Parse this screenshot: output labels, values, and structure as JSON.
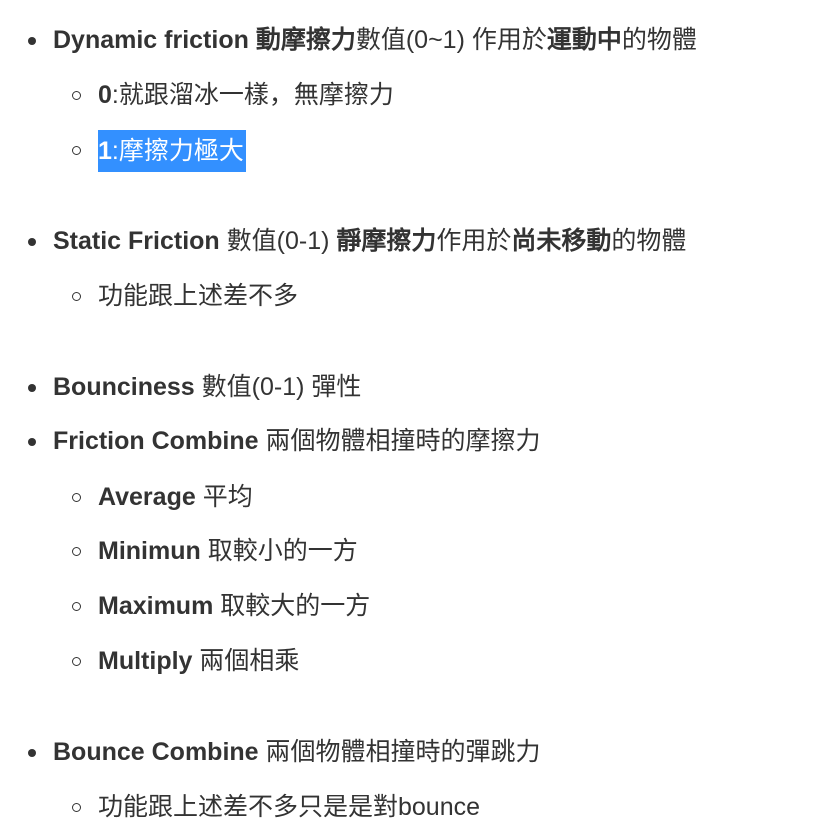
{
  "items": [
    {
      "id": "dynamic-friction",
      "level": 1,
      "parts": [
        {
          "t": "Dynamic friction ",
          "b": true
        },
        {
          "t": "動摩擦力",
          "b": true
        },
        {
          "t": "數值(0~1) 作用於",
          "b": false
        },
        {
          "t": "運動中",
          "b": true
        },
        {
          "t": "的物體",
          "b": false
        }
      ]
    },
    {
      "id": "dynamic-friction-0",
      "level": 2,
      "parts": [
        {
          "t": "0",
          "b": true
        },
        {
          "t": ":就跟溜冰一樣，無摩擦力",
          "b": false
        }
      ]
    },
    {
      "id": "dynamic-friction-1",
      "level": 2,
      "highlight": true,
      "parts": [
        {
          "t": "1",
          "b": true
        },
        {
          "t": ":摩擦力極大",
          "b": false
        }
      ]
    },
    {
      "id": "static-friction",
      "level": 1,
      "parts": [
        {
          "t": "Static Friction ",
          "b": true
        },
        {
          "t": "數值(0-1) ",
          "b": false
        },
        {
          "t": "靜摩擦力",
          "b": true
        },
        {
          "t": "作用於",
          "b": false
        },
        {
          "t": "尚未移動",
          "b": true
        },
        {
          "t": "的物體",
          "b": false
        }
      ]
    },
    {
      "id": "static-friction-note",
      "level": 2,
      "parts": [
        {
          "t": "功能跟上述差不多",
          "b": false
        }
      ]
    },
    {
      "id": "bounciness",
      "level": 1,
      "parts": [
        {
          "t": "Bounciness ",
          "b": true
        },
        {
          "t": "數值(0-1) 彈性",
          "b": false
        }
      ]
    },
    {
      "id": "friction-combine",
      "level": 1,
      "parts": [
        {
          "t": "Friction Combine ",
          "b": true
        },
        {
          "t": "兩個物體相撞時的摩擦力",
          "b": false
        }
      ]
    },
    {
      "id": "average",
      "level": 2,
      "parts": [
        {
          "t": "Average ",
          "b": true
        },
        {
          "t": "平均",
          "b": false
        }
      ]
    },
    {
      "id": "minimun",
      "level": 2,
      "parts": [
        {
          "t": "Minimun ",
          "b": true
        },
        {
          "t": "取較小的一方",
          "b": false
        }
      ]
    },
    {
      "id": "maximum",
      "level": 2,
      "parts": [
        {
          "t": "Maximum ",
          "b": true
        },
        {
          "t": "取較大的一方",
          "b": false
        }
      ]
    },
    {
      "id": "multiply",
      "level": 2,
      "parts": [
        {
          "t": "Multiply ",
          "b": true
        },
        {
          "t": "兩個相乘",
          "b": false
        }
      ]
    },
    {
      "id": "bounce-combine",
      "level": 1,
      "parts": [
        {
          "t": "Bounce Combine ",
          "b": true
        },
        {
          "t": "兩個物體相撞時的彈跳力",
          "b": false
        }
      ]
    },
    {
      "id": "bounce-combine-note",
      "level": 2,
      "parts": [
        {
          "t": "功能跟上述差不多只是是對bounce",
          "b": false
        }
      ]
    }
  ]
}
